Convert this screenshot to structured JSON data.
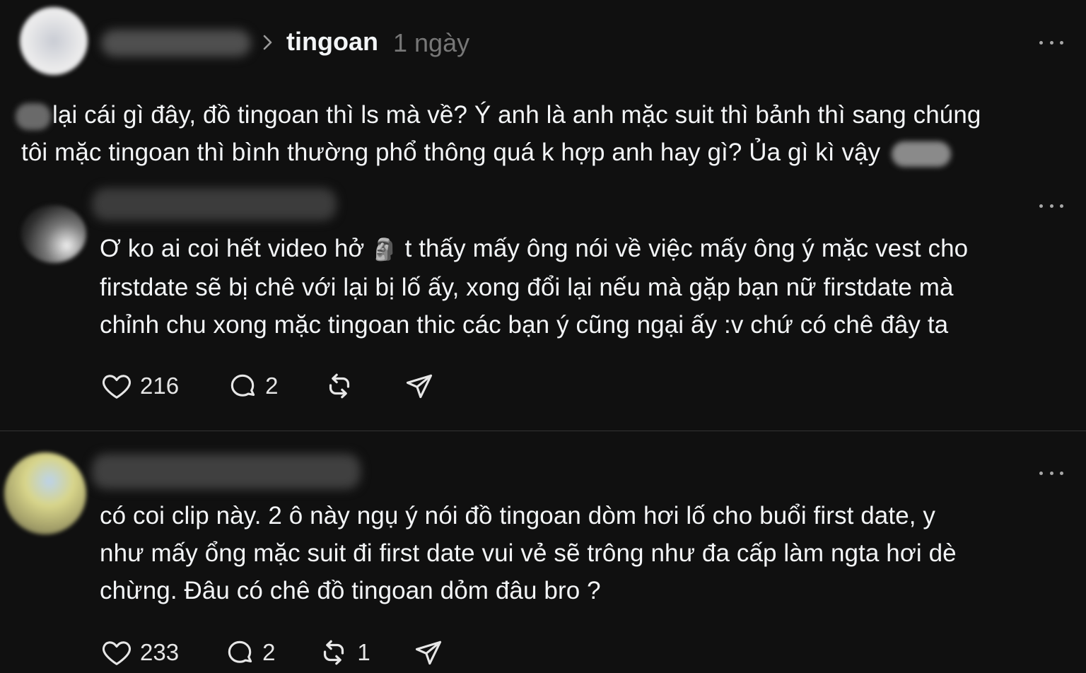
{
  "post": {
    "username": "tingoan",
    "time": "1 ngày",
    "text_line1": "lại cái gì đây, đồ tingoan thì ls mà về? Ý anh là anh mặc suit thì bảnh thì sang chúng",
    "text_line2": "tôi mặc tingoan thì bình thường phổ thông quá k hợp anh hay gì? Ủa gì kì vậy"
  },
  "replies": [
    {
      "line1_a": "Ơ ko ai coi hết video hở",
      "emoji": "🗿",
      "line1_b": " t thấy mấy ông nói về việc mấy ông ý mặc vest cho",
      "line2": "firstdate sẽ bị chê với lại bị lố ấy, xong đổi lại nếu mà gặp bạn nữ firstdate mà",
      "line3": "chỉnh chu xong mặc tingoan thic các bạn ý cũng ngại ấy :v chứ có chê đây ta",
      "likes": "216",
      "comments": "2",
      "reposts": "",
      "icons": [
        "heart-icon",
        "comment-icon",
        "repost-icon",
        "share-icon"
      ]
    },
    {
      "line1": "có coi clip này. 2 ô này ngụ ý nói đồ tingoan dòm hơi lố cho buổi first date, y",
      "line2": "như mấy ổng mặc suit đi first date vui vẻ sẽ trông như đa cấp làm ngta hơi dè",
      "line3": "chừng. Đâu có chê đồ tingoan dỏm đâu bro ?",
      "likes": "233",
      "comments": "2",
      "reposts": "1",
      "icons": [
        "heart-icon",
        "comment-icon",
        "repost-icon",
        "share-icon"
      ]
    }
  ],
  "colors": {
    "background": "#101010",
    "text": "#f3f5f7",
    "muted": "#777777",
    "divider": "#333333"
  }
}
